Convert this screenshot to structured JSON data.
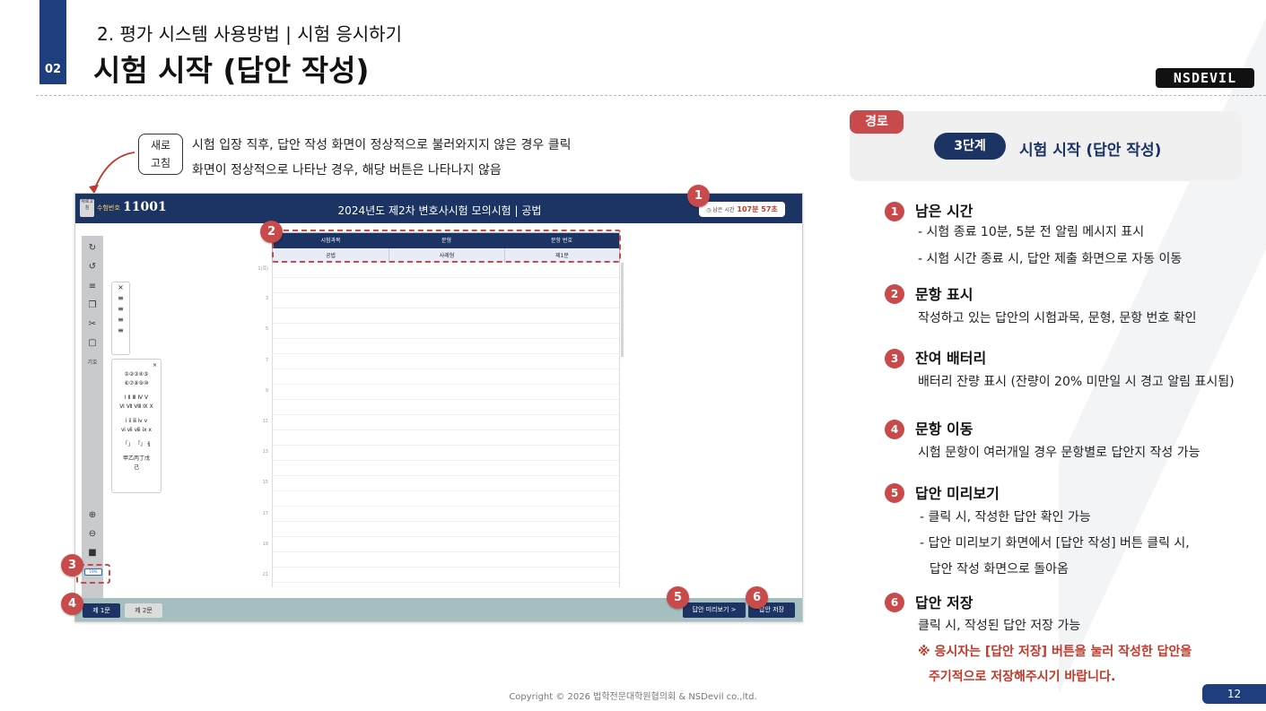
{
  "header": {
    "section_number": "02",
    "subtitle": "2. 평가 시스템 사용방법 | 시험 응시하기",
    "title": "시험 시작 (답안 작성)",
    "logo": "NSDEVIL"
  },
  "refresh": {
    "label_line1": "새로",
    "label_line2": "고침",
    "note1": "시험 입장 직후, 답안 작성 화면이 정상적으로 불러와지지 않은 경우 클릭",
    "note2": "화면이 정상적으로 나타난 경우, 해당 버튼은 나타나지 않음"
  },
  "app": {
    "logo_text": "새로고침",
    "seat_label": "수험번호",
    "seat_number": "11001",
    "exam_title": "2024년도 제2차 변호사시험 모의시험 | 공법",
    "timer_label": "남은 시간",
    "timer_value": "107분 57초",
    "table_headers": [
      "시험과목",
      "문형",
      "문항 번호"
    ],
    "table_values": [
      "공법",
      "사례형",
      "제1문"
    ],
    "line_numbers": [
      "1(쪽)",
      "3",
      "5",
      "7",
      "9",
      "11",
      "13",
      "15",
      "17",
      "19",
      "21"
    ],
    "toolbar_label": "기호",
    "battery": "19%",
    "symbols": [
      "①②③④⑤",
      "⑥⑦⑧⑨⑩",
      "Ⅰ Ⅱ Ⅲ Ⅳ Ⅴ",
      "Ⅵ Ⅶ Ⅷ Ⅸ Ⅹ",
      "ⅰ ⅱ ⅲ ⅳ ⅴ",
      "ⅵ ⅶ ⅷ ⅸ ⅹ",
      "「」 『』 §",
      "甲乙丙丁戊",
      "己"
    ],
    "tabs": [
      "제 1문",
      "제 2문"
    ],
    "preview_button": "답안 미리보기 >",
    "save_button": "답안 저장"
  },
  "markers": [
    "1",
    "2",
    "3",
    "4",
    "5",
    "6"
  ],
  "route": {
    "tag": "경로",
    "step": "3단계",
    "title": "시험 시작 (답안 작성)"
  },
  "items": [
    {
      "num": "1",
      "heading": "남은 시간",
      "lines": [
        "- 시험 종료 10분, 5분 전 알림 메시지 표시",
        "- 시험 시간 종료 시, 답안 제출 화면으로 자동 이동"
      ]
    },
    {
      "num": "2",
      "heading": "문항 표시",
      "lines": [
        "작성하고 있는 답안의 시험과목, 문형, 문항 번호 확인"
      ]
    },
    {
      "num": "3",
      "heading": "잔여 배터리",
      "lines": [
        "배터리 잔량 표시 (잔량이 20% 미만일 시 경고 알림 표시됨)"
      ]
    },
    {
      "num": "4",
      "heading": "문항 이동",
      "lines": [
        "시험 문항이 여러개일 경우 문항별로 답안지 작성 가능"
      ]
    },
    {
      "num": "5",
      "heading": "답안 미리보기",
      "lines": [
        "- 클릭 시, 작성한 답안 확인 가능",
        "- 답안 미리보기 화면에서 [답안 작성] 버튼 클릭 시,",
        "  답안 작성 화면으로 돌아옴"
      ]
    },
    {
      "num": "6",
      "heading": "답안 저장",
      "lines": [
        "클릭 시, 작성된 답안 저장 가능"
      ]
    }
  ],
  "warning": {
    "line1": "※ 응시자는 [답안 저장] 버튼을 눌러 작성한 답안을",
    "line2": "주기적으로 저장해주시기 바랍니다."
  },
  "footer": {
    "copyright": "Copyright © 2026 법학전문대학원협의회 & NSDevil co.,ltd.",
    "page": "12"
  },
  "colors": {
    "navy": "#1b3464",
    "accent_red": "#c84a4a",
    "warning_red": "#c0392b"
  }
}
